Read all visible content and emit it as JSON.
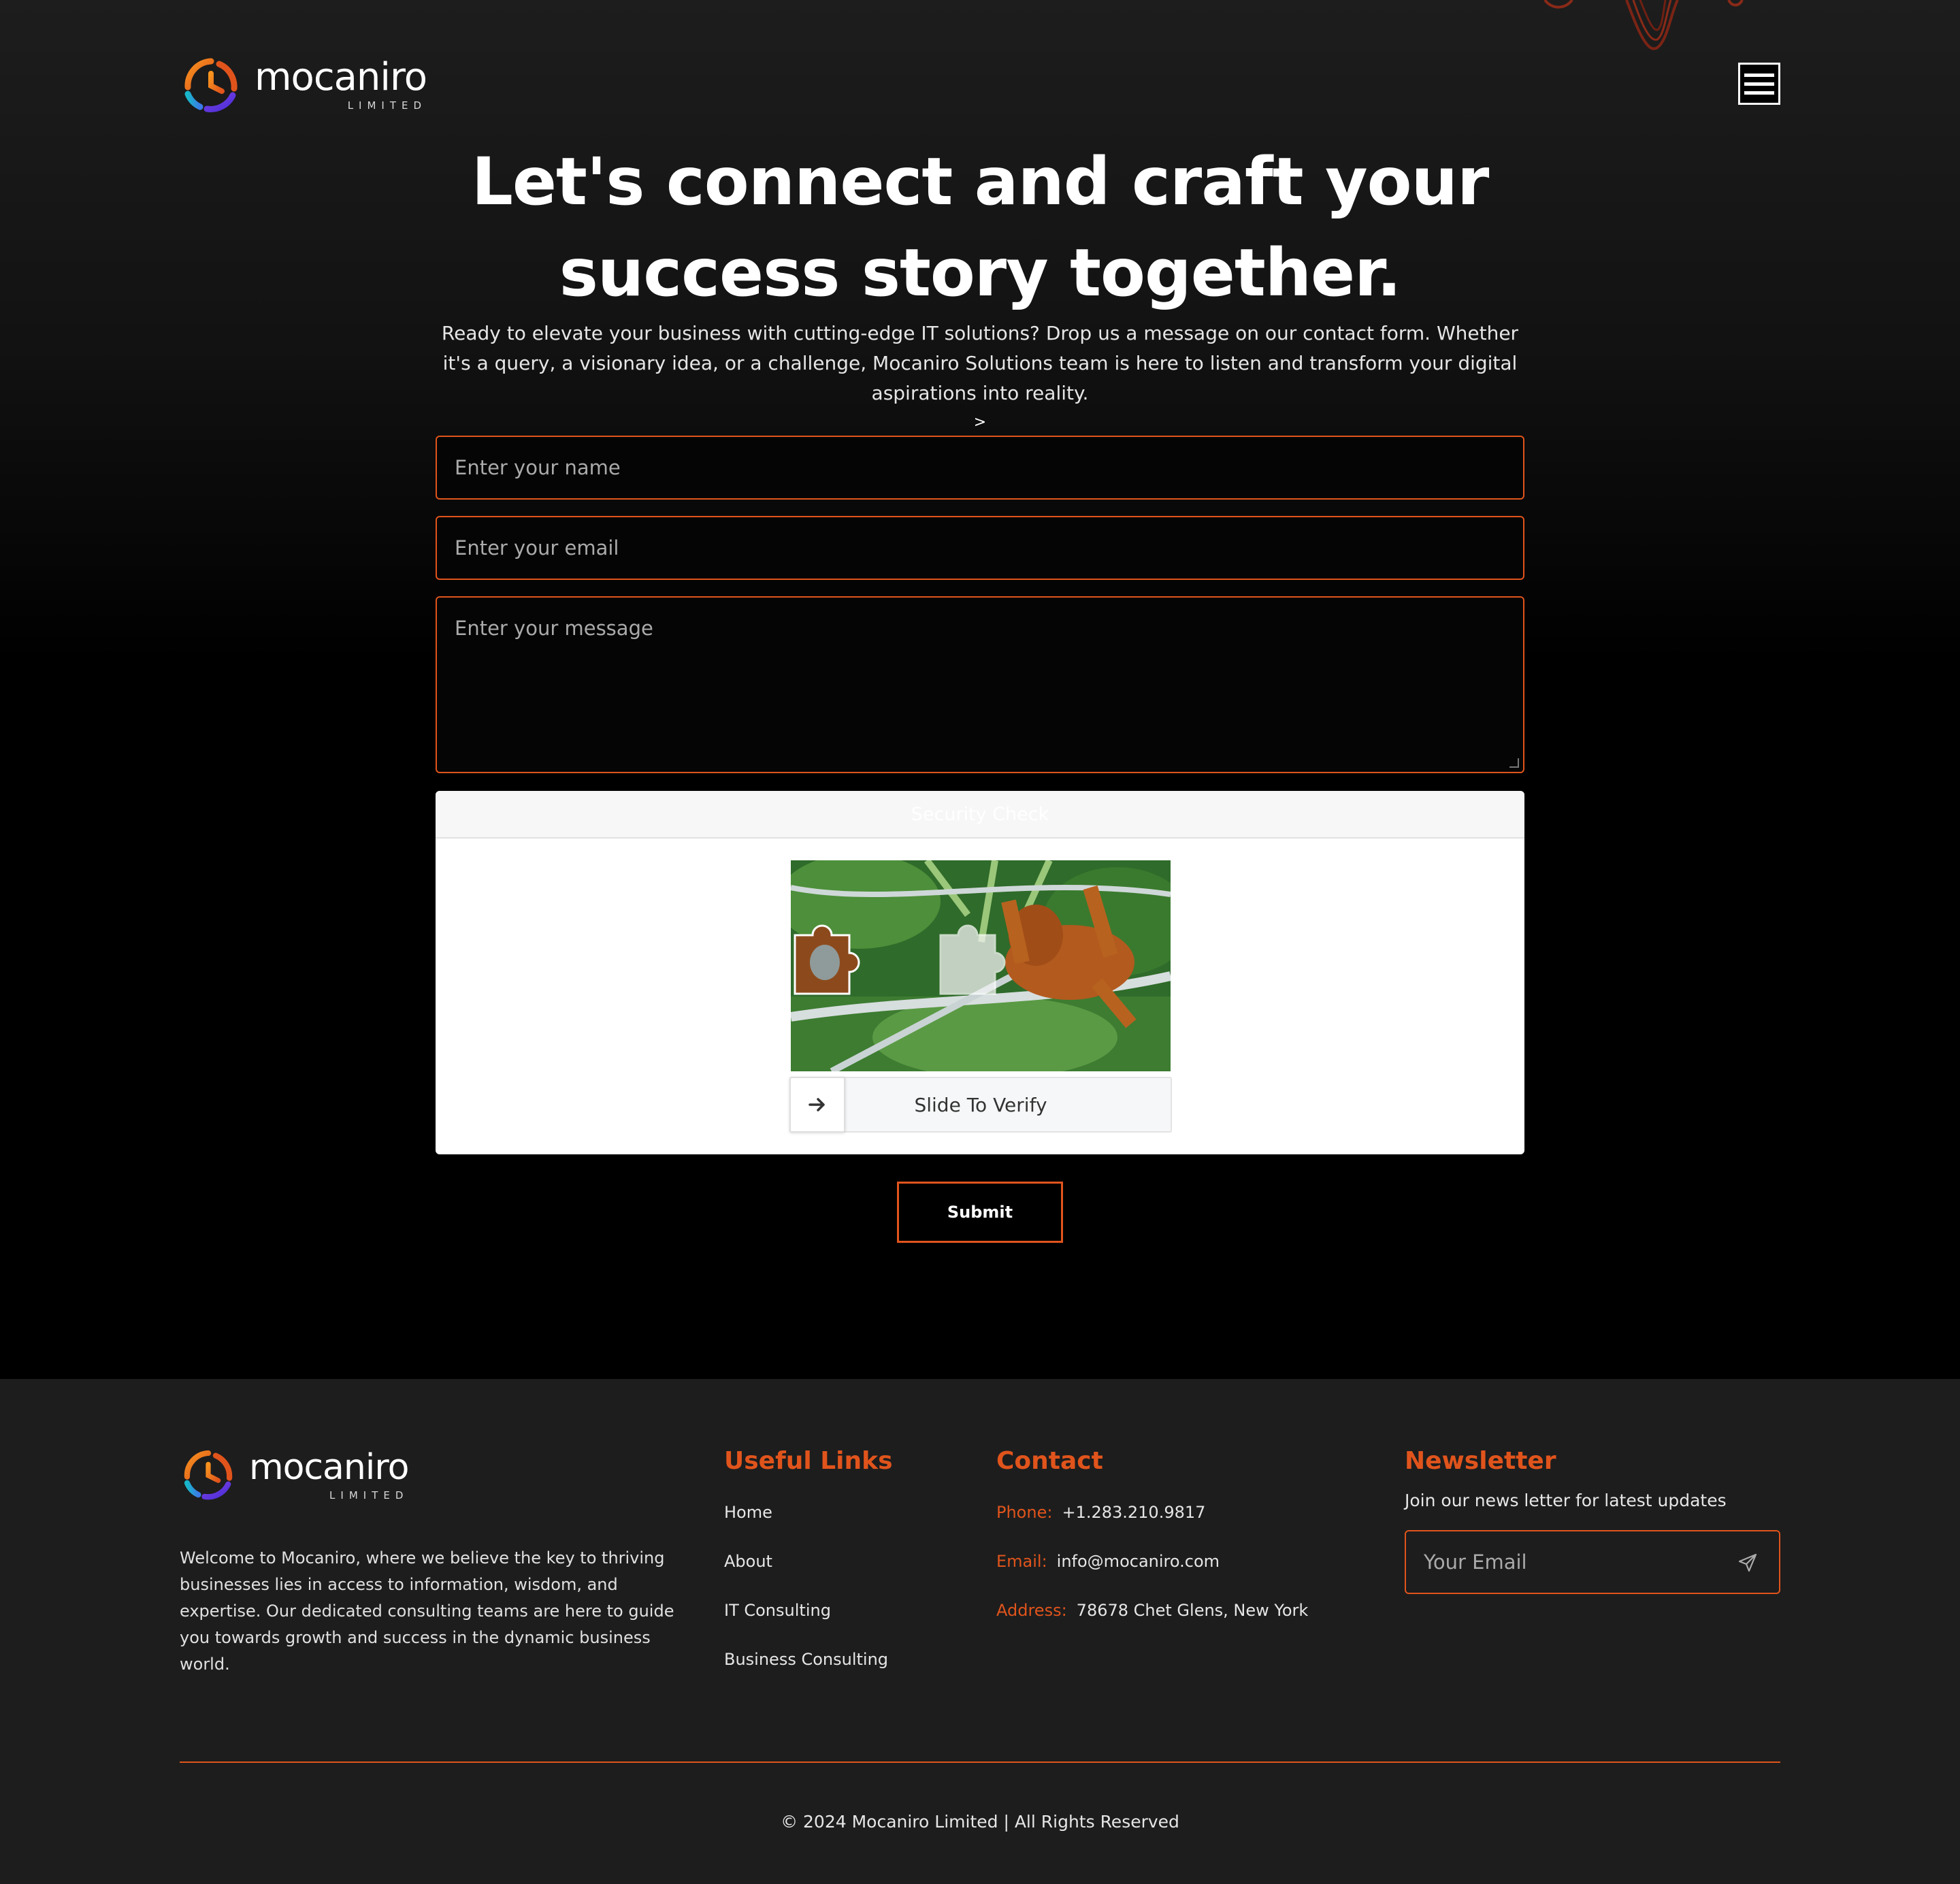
{
  "header": {
    "brand": "mocaniro",
    "brand_sub": "LIMITED",
    "menu_icon": "hamburger-menu-icon"
  },
  "hero": {
    "headline_line1": "Let's connect and craft your",
    "headline_line2": "success story together.",
    "intro": "Ready to elevate your business with cutting-edge IT solutions? Drop us a message on our contact form. Whether it's a query, a visionary idea, or a challenge, Mocaniro Solutions team is here to listen and transform your digital aspirations into reality.",
    "caret": ">"
  },
  "form": {
    "name_placeholder": "Enter your name",
    "email_placeholder": "Enter your email",
    "message_placeholder": "Enter your message",
    "captcha_title": "Security Check",
    "slider_label": "Slide To Verify",
    "slider_icon": "arrow-right-icon",
    "submit_label": "Submit"
  },
  "footer": {
    "brand": "mocaniro",
    "brand_sub": "LIMITED",
    "about": "Welcome to Mocaniro, where we believe the key to thriving businesses lies in access to information, wisdom, and expertise. Our dedicated consulting teams are here to guide you towards growth and success in the dynamic business world.",
    "links_title": "Useful Links",
    "links": [
      "Home",
      "About",
      "IT Consulting",
      "Business Consulting"
    ],
    "contact_title": "Contact",
    "phone_label": "Phone:",
    "phone": "+1.283.210.9817",
    "email_label": "Email:",
    "email": "info@mocaniro.com",
    "address_label": "Address:",
    "address": "78678 Chet Glens, New York",
    "newsletter_title": "Newsletter",
    "newsletter_text": "Join our news letter for latest updates",
    "newsletter_placeholder": "Your Email",
    "newsletter_icon": "send-icon",
    "copyright": "2024 Mocaniro Limited | All Rights Reserved"
  },
  "colors": {
    "accent": "#e0541c",
    "background": "#000000",
    "footer_bg": "#1d1d1d"
  }
}
